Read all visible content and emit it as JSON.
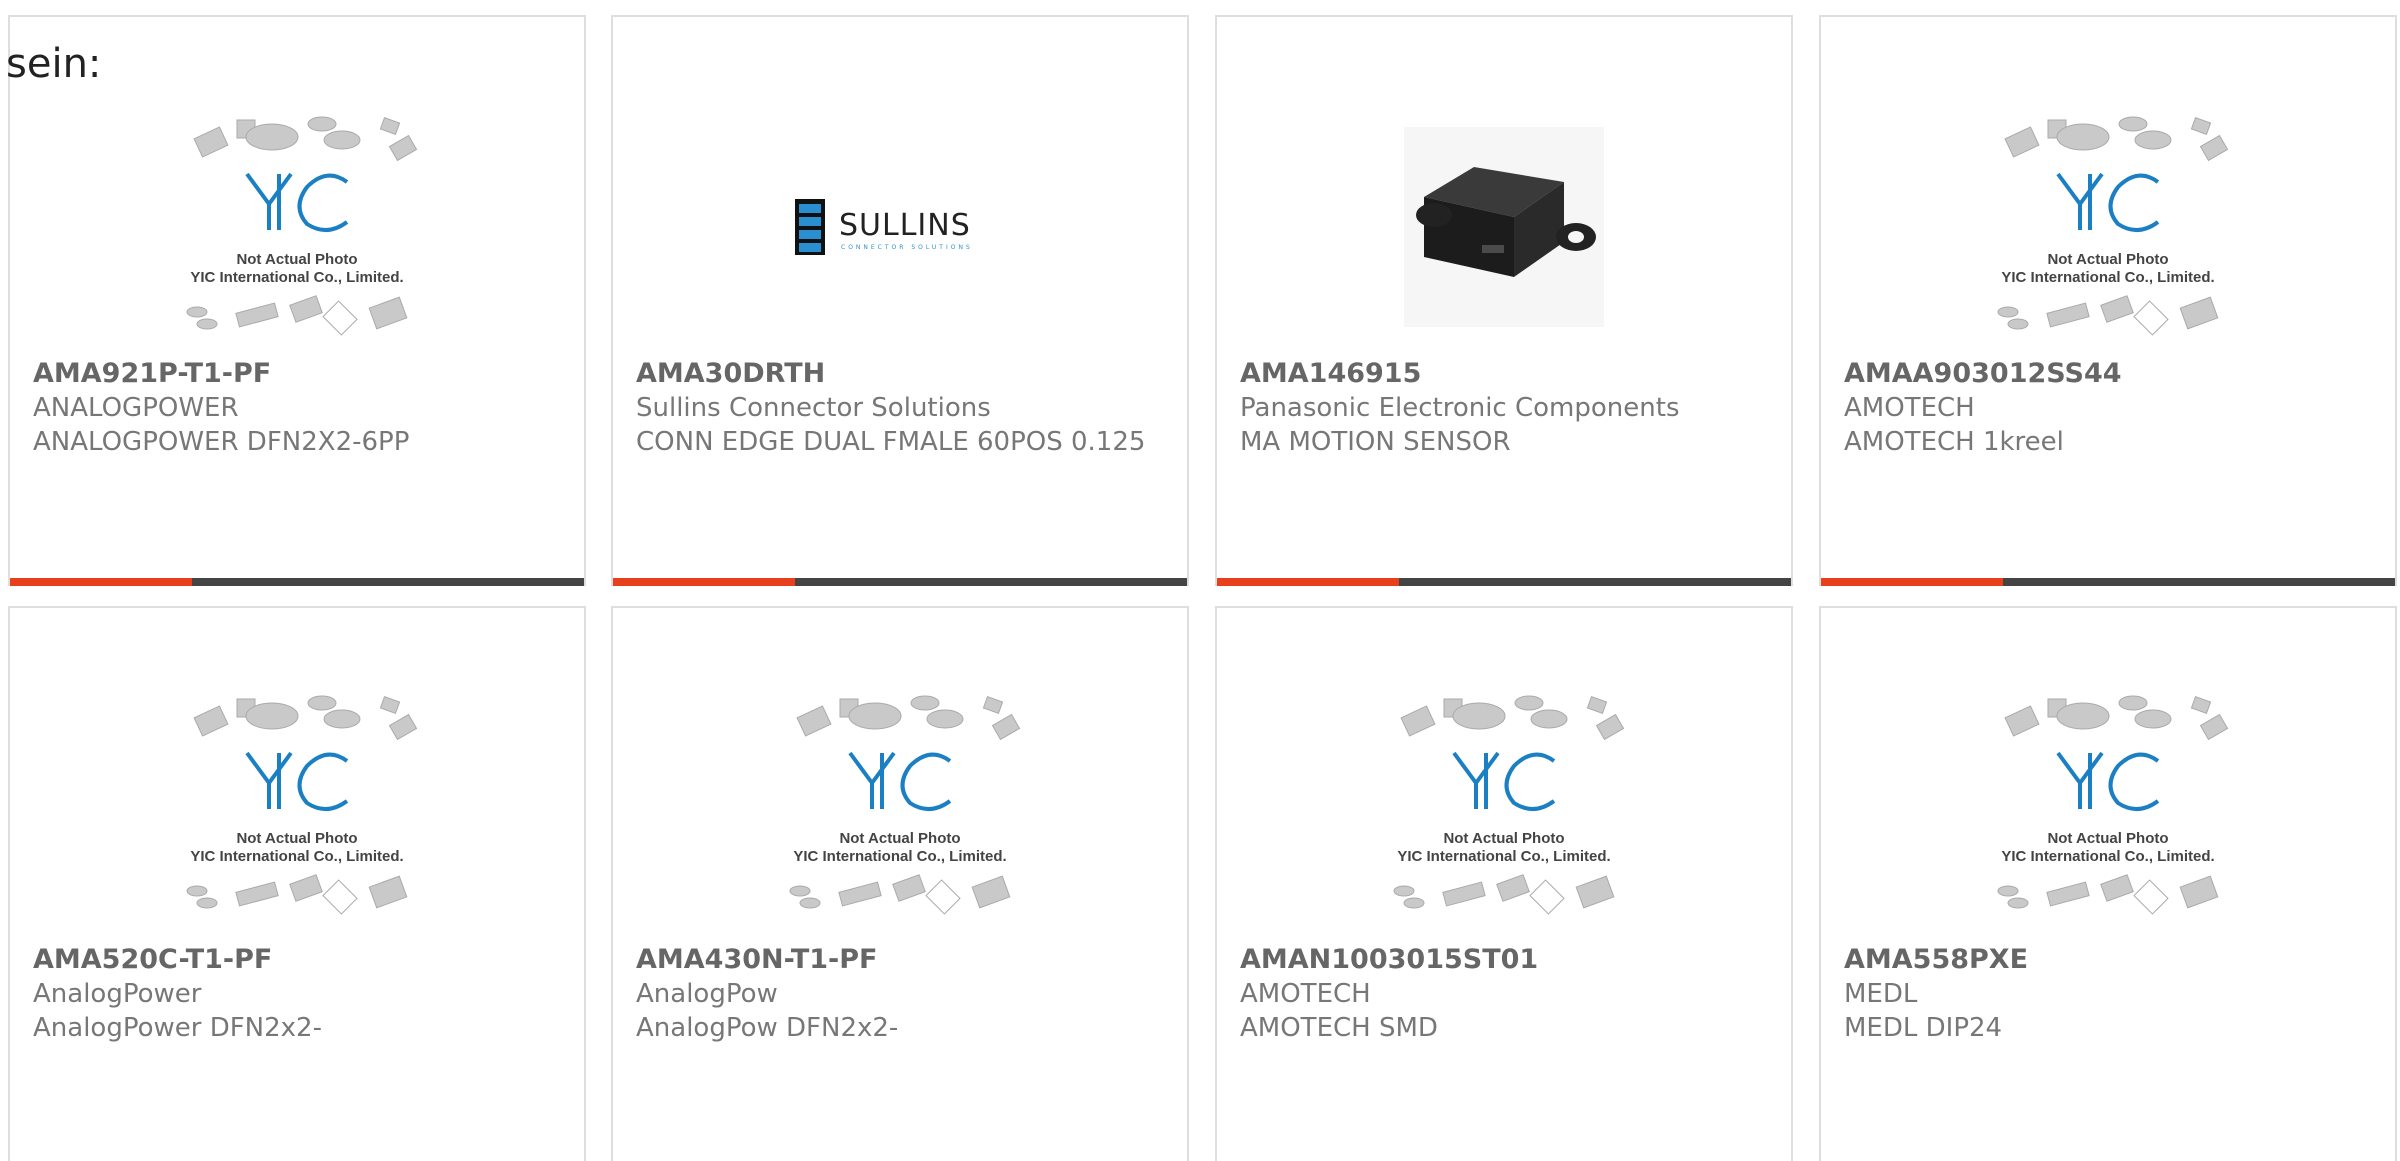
{
  "intro_text": "sein:",
  "products": [
    {
      "part": "AMA921P-T1-PF",
      "manufacturer": "ANALOGPOWER",
      "description": "ANALOGPOWER DFN2X2-6PP",
      "image": "yic-placeholder",
      "placeholder_line1": "Not Actual Photo",
      "placeholder_line2": "YIC International Co., Limited."
    },
    {
      "part": "AMA30DRTH",
      "manufacturer": "Sullins Connector Solutions",
      "description": "CONN EDGE DUAL FMALE 60POS 0.125",
      "image": "sullins-logo",
      "logo_text": "SULLINS",
      "logo_sub": "CONNECTOR SOLUTIONS"
    },
    {
      "part": "AMA146915",
      "manufacturer": "Panasonic Electronic Components",
      "description": "MA MOTION SENSOR",
      "image": "motion-sensor-photo"
    },
    {
      "part": "AMAA903012SS44",
      "manufacturer": "AMOTECH",
      "description": "AMOTECH 1kreel",
      "image": "yic-placeholder",
      "placeholder_line1": "Not Actual Photo",
      "placeholder_line2": "YIC International Co., Limited."
    },
    {
      "part": "AMA520C-T1-PF",
      "manufacturer": "AnalogPower",
      "description": "AnalogPower DFN2x2-",
      "image": "yic-placeholder",
      "placeholder_line1": "Not Actual Photo",
      "placeholder_line2": "YIC International Co., Limited."
    },
    {
      "part": "AMA430N-T1-PF",
      "manufacturer": "AnalogPow",
      "description": "AnalogPow DFN2x2-",
      "image": "yic-placeholder",
      "placeholder_line1": "Not Actual Photo",
      "placeholder_line2": "YIC International Co., Limited."
    },
    {
      "part": "AMAN1003015ST01",
      "manufacturer": "AMOTECH",
      "description": "AMOTECH SMD",
      "image": "yic-placeholder",
      "placeholder_line1": "Not Actual Photo",
      "placeholder_line2": "YIC International Co., Limited."
    },
    {
      "part": "AMA558PXE",
      "manufacturer": "MEDL",
      "description": "MEDL DIP24",
      "image": "yic-placeholder",
      "placeholder_line1": "Not Actual Photo",
      "placeholder_line2": "YIC International Co., Limited."
    }
  ],
  "colors": {
    "accent": "#e8401c",
    "bar": "#444444",
    "border": "#dedede",
    "logo_blue": "#1b7fc4"
  }
}
